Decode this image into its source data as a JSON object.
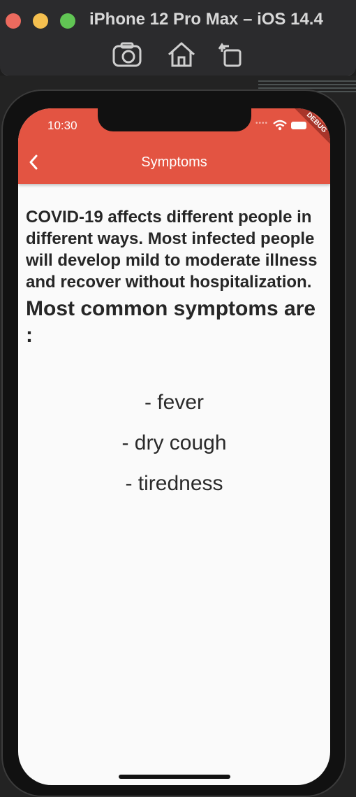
{
  "window": {
    "title": "iPhone 12 Pro Max – iOS 14.4"
  },
  "status_bar": {
    "time": "10:30",
    "debug_label": "DEBUG"
  },
  "app_bar": {
    "title": "Symptoms"
  },
  "content": {
    "intro": "COVID-19 affects different people in different ways. Most infected people will develop mild to moderate illness and recover without hospitalization.",
    "heading": "Most common symptoms are :",
    "symptoms": [
      "- fever",
      "- dry cough",
      "- tiredness"
    ]
  },
  "colors": {
    "app_bar": "#e35442",
    "background": "#fafafa",
    "text": "#262626"
  },
  "icons": {
    "back": "chevron-left-icon",
    "screenshot": "camera-icon",
    "home": "home-icon",
    "rotate": "rotate-icon",
    "wifi": "wifi-icon",
    "battery": "battery-icon"
  }
}
